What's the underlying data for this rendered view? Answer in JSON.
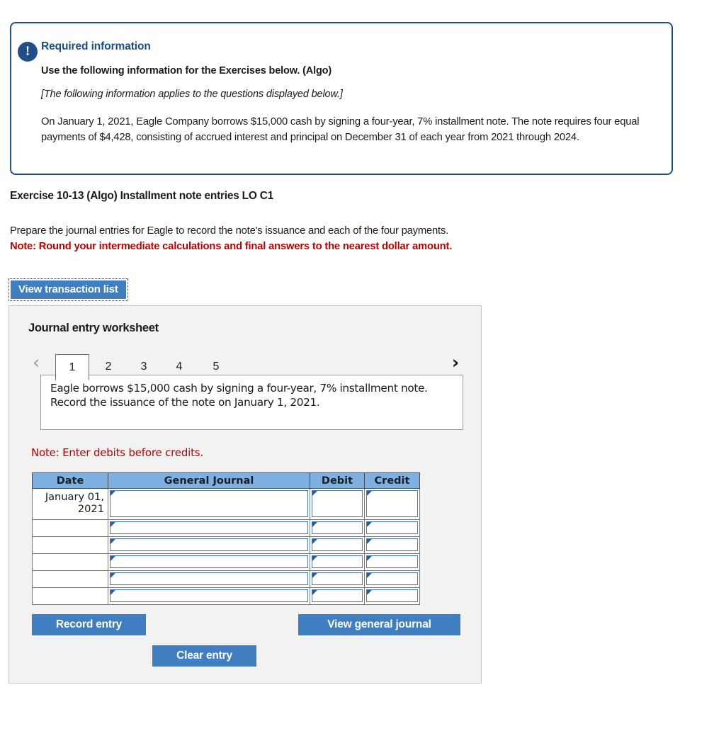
{
  "required_info": {
    "icon": "exclamation-icon",
    "title": "Required information",
    "subtitle": "Use the following information for the Exercises below. (Algo)",
    "italic_note": "[The following information applies to the questions displayed below.]",
    "body": "On January 1, 2021, Eagle Company borrows $15,000 cash by signing a four-year, 7% installment note. The note requires four equal payments of $4,428, consisting of accrued interest and principal on December 31 of each year from 2021 through 2024.",
    "border_color": "#1f4e89",
    "title_color": "#1a4c86"
  },
  "exercise": {
    "title": "Exercise 10-13 (Algo) Installment note entries LO C1",
    "prompt": "Prepare the journal entries for Eagle to record the note's issuance and each of the four payments.",
    "note": "Note: Round your intermediate calculations and final answers to the nearest dollar amount.",
    "note_color": "#c00000"
  },
  "transaction_list_button": {
    "label": "View transaction list",
    "focused": true,
    "color": "#3f7fc1"
  },
  "worksheet": {
    "title": "Journal entry worksheet",
    "nav": {
      "prev_icon": "chevron-left-icon",
      "next_icon": "chevron-right-icon",
      "prev_enabled": false,
      "next_enabled": true
    },
    "tabs": [
      {
        "label": "1",
        "active": true
      },
      {
        "label": "2",
        "active": false
      },
      {
        "label": "3",
        "active": false
      },
      {
        "label": "4",
        "active": false
      },
      {
        "label": "5",
        "active": false
      }
    ],
    "description": "Eagle borrows $15,000 cash by signing a four-year, 7% installment note. Record the issuance of the note on January 1, 2021.",
    "debits_note": "Note: Enter debits before credits.",
    "table": {
      "headers": [
        "Date",
        "General Journal",
        "Debit",
        "Credit"
      ],
      "header_color": "#7fb0e2",
      "rows": [
        {
          "date": "January 01, 2021",
          "general_journal": "",
          "debit": "",
          "credit": "",
          "tall": true
        },
        {
          "date": "",
          "general_journal": "",
          "debit": "",
          "credit": "",
          "tall": false
        },
        {
          "date": "",
          "general_journal": "",
          "debit": "",
          "credit": "",
          "tall": false
        },
        {
          "date": "",
          "general_journal": "",
          "debit": "",
          "credit": "",
          "tall": false
        },
        {
          "date": "",
          "general_journal": "",
          "debit": "",
          "credit": "",
          "tall": false
        },
        {
          "date": "",
          "general_journal": "",
          "debit": "",
          "credit": "",
          "tall": false
        }
      ]
    },
    "buttons": {
      "record": "Record entry",
      "clear": "Clear entry",
      "view_journal": "View general journal"
    }
  }
}
